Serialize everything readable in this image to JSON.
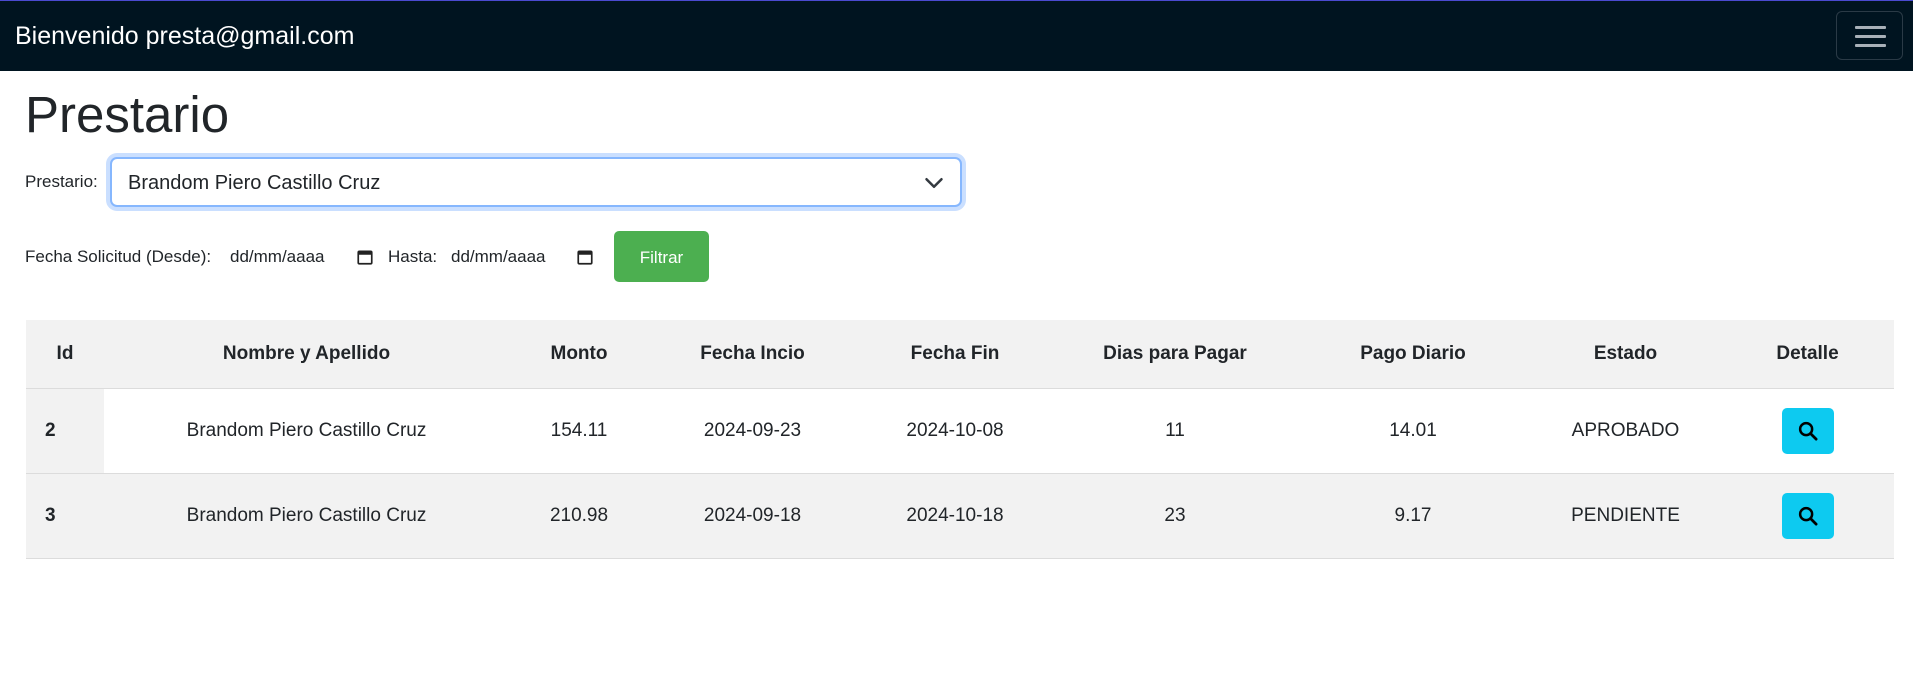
{
  "navbar": {
    "welcome": "Bienvenido presta@gmail.com",
    "menu_icon": "hamburger-icon"
  },
  "page": {
    "title": "Prestario"
  },
  "filters": {
    "prestario_label": "Prestario:",
    "prestario_selected": "Brandom Piero Castillo Cruz",
    "fecha_desde_label": "Fecha Solicitud (Desde):",
    "fecha_desde_value": "dd/mm/aaaa",
    "hasta_label": "Hasta:",
    "hasta_value": "dd/mm/aaaa",
    "filter_button": "Filtrar",
    "calendar_icon": "calendar-icon",
    "dropdown_icon": "chevron-down-icon"
  },
  "table": {
    "headers": [
      "Id",
      "Nombre y Apellido",
      "Monto",
      "Fecha Incio",
      "Fecha Fin",
      "Dias para Pagar",
      "Pago Diario",
      "Estado",
      "Detalle"
    ],
    "rows": [
      {
        "id": "2",
        "nombre": "Brandom Piero Castillo Cruz",
        "monto": "154.11",
        "fecha_inicio": "2024-09-23",
        "fecha_fin": "2024-10-08",
        "dias": "11",
        "pago_diario": "14.01",
        "estado": "APROBADO"
      },
      {
        "id": "3",
        "nombre": "Brandom Piero Castillo Cruz",
        "monto": "210.98",
        "fecha_inicio": "2024-09-18",
        "fecha_fin": "2024-10-18",
        "dias": "23",
        "pago_diario": "9.17",
        "estado": "PENDIENTE"
      }
    ],
    "detail_icon": "search-icon"
  },
  "colors": {
    "navbar_bg": "#001420",
    "filter_button_bg": "#4caf50",
    "detail_button_bg": "#0dcaf0",
    "header_bg": "#f2f2f2"
  }
}
